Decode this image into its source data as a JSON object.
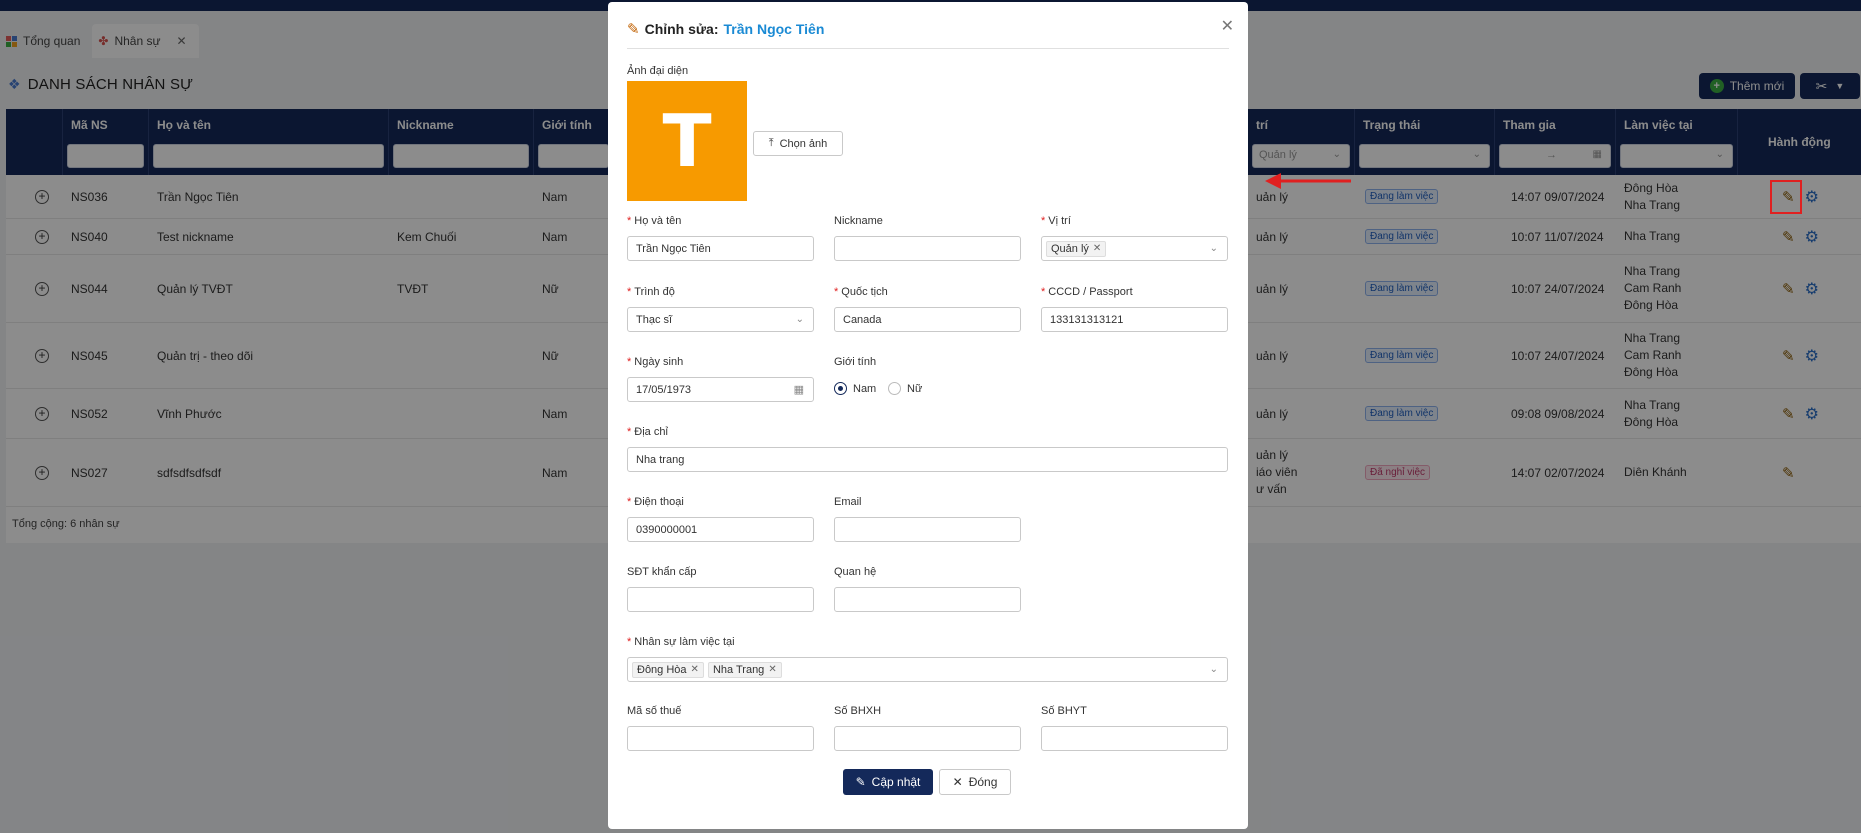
{
  "tabs": [
    {
      "label": "Tổng quan"
    },
    {
      "label": "Nhân sự"
    }
  ],
  "page_title": "DANH SÁCH NHÂN SỰ",
  "buttons": {
    "add": "Thêm mới"
  },
  "table": {
    "columns": {
      "code": "Mã NS",
      "name": "Họ và tên",
      "nickname": "Nickname",
      "gender": "Giới tính",
      "position": "trí",
      "status": "Trạng thái",
      "joined": "Tham gia",
      "workplace": "Làm việc tại",
      "actions": "Hành động"
    },
    "filters": {
      "position": "Quản lý",
      "joined_sep": "→"
    },
    "rows": [
      {
        "code": "NS036",
        "name": "Trần Ngọc Tiên",
        "nickname": "",
        "gender": "Nam",
        "position": [
          "uản lý"
        ],
        "status": "Đang làm việc",
        "joined": "14:07 09/07/2024",
        "workplace": [
          "Đông Hòa",
          "Nha Trang"
        ]
      },
      {
        "code": "NS040",
        "name": "Test nickname",
        "nickname": "Kem Chuối",
        "gender": "Nam",
        "position": [
          "uản lý"
        ],
        "status": "Đang làm việc",
        "joined": "10:07 11/07/2024",
        "workplace": [
          "Nha Trang"
        ]
      },
      {
        "code": "NS044",
        "name": "Quản lý TVĐT",
        "nickname": "TVĐT",
        "gender": "Nữ",
        "position": [
          "uản lý"
        ],
        "status": "Đang làm việc",
        "joined": "10:07 24/07/2024",
        "workplace": [
          "Nha Trang",
          "Cam Ranh",
          "Đông Hòa"
        ]
      },
      {
        "code": "NS045",
        "name": "Quản trị - theo dõi",
        "nickname": "",
        "gender": "Nữ",
        "position": [
          "uản lý"
        ],
        "status": "Đang làm việc",
        "joined": "10:07 24/07/2024",
        "workplace": [
          "Nha Trang",
          "Cam Ranh",
          "Đông Hòa"
        ]
      },
      {
        "code": "NS052",
        "name": "Vĩnh Phước",
        "nickname": "",
        "gender": "Nam",
        "position": [
          "uản lý"
        ],
        "status": "Đang làm việc",
        "joined": "09:08 09/08/2024",
        "workplace": [
          "Nha Trang",
          "Đông Hòa"
        ]
      },
      {
        "code": "NS027",
        "name": "sdfsdfsdfsdf",
        "nickname": "",
        "gender": "Nam",
        "position": [
          "uản lý",
          "iáo viên",
          "ư vấn"
        ],
        "status": "Đã nghỉ việc",
        "joined": "14:07 02/07/2024",
        "workplace": [
          "Diên Khánh"
        ]
      }
    ],
    "total": "Tổng cộng: 6 nhân sự"
  },
  "modal": {
    "title_prefix": "Chỉnh sửa:",
    "title_name": "Trần Ngọc Tiên",
    "avatar_label": "Ảnh đại diện",
    "avatar_letter": "T",
    "upload_label": "Chọn ảnh",
    "fields": {
      "fullname": {
        "label": "Họ và tên",
        "value": "Trần Ngọc Tiên"
      },
      "nickname": {
        "label": "Nickname",
        "value": ""
      },
      "position": {
        "label": "Vị trí",
        "tags": [
          "Quản lý"
        ]
      },
      "education": {
        "label": "Trình độ",
        "value": "Thạc sĩ"
      },
      "nationality": {
        "label": "Quốc tịch",
        "value": "Canada"
      },
      "idcard": {
        "label": "CCCD / Passport",
        "value": "133131313121"
      },
      "dob": {
        "label": "Ngày sinh",
        "value": "17/05/1973"
      },
      "gender": {
        "label": "Giới tính",
        "options": [
          "Nam",
          "Nữ"
        ],
        "selected": "Nam"
      },
      "address": {
        "label": "Địa chỉ",
        "value": "Nha trang"
      },
      "phone": {
        "label": "Điện thoại",
        "value": "0390000001"
      },
      "email": {
        "label": "Email",
        "value": ""
      },
      "emergency_phone": {
        "label": "SĐT khẩn cấp",
        "value": ""
      },
      "relation": {
        "label": "Quan hệ",
        "value": ""
      },
      "workplaces": {
        "label": "Nhân sự làm việc tại",
        "tags": [
          "Đông Hòa",
          "Nha Trang"
        ]
      },
      "tax_code": {
        "label": "Mã số thuế",
        "value": ""
      },
      "social_insurance": {
        "label": "Số BHXH",
        "value": ""
      },
      "health_insurance": {
        "label": "Số BHYT",
        "value": ""
      }
    },
    "submit_label": "Cập nhật",
    "close_label": "Đóng"
  }
}
